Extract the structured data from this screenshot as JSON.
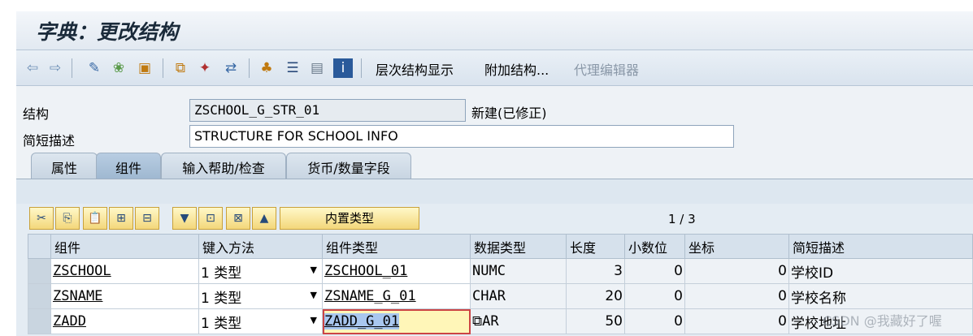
{
  "window": {
    "title": "字典：更改结构"
  },
  "toolbar": {
    "items": [
      "层次结构显示",
      "附加结构...",
      "代理编辑器"
    ]
  },
  "form": {
    "structure_label": "结构",
    "structure_value": "ZSCHOOL_G_STR_01",
    "status": "新建(已修正)",
    "desc_label": "简短描述",
    "desc_value": "STRUCTURE FOR SCHOOL INFO"
  },
  "tabs": [
    "属性",
    "组件",
    "输入帮助/检查",
    "货币/数量字段"
  ],
  "panel": {
    "builtin_type_label": "内置类型",
    "pager": "1 / 3"
  },
  "grid": {
    "headers": [
      "组件",
      "键入方法",
      "组件类型",
      "数据类型",
      "长度",
      "小数位",
      "坐标",
      "简短描述"
    ],
    "rows": [
      {
        "component": "ZSCHOOL",
        "method": "1 类型",
        "comp_type": "ZSCHOOL_01",
        "data_type": "NUMC",
        "length": "3",
        "decimals": "0",
        "coord": "0",
        "desc": "学校ID"
      },
      {
        "component": "ZSNAME",
        "method": "1 类型",
        "comp_type": "ZSNAME_G_01",
        "data_type": "CHAR",
        "length": "20",
        "decimals": "0",
        "coord": "0",
        "desc": "学校名称"
      },
      {
        "component": "ZADD",
        "method": "1 类型",
        "comp_type": "ZADD_G_01",
        "data_type": "AR",
        "length": "50",
        "decimals": "0",
        "coord": "0",
        "desc": "学校地址"
      }
    ]
  },
  "watermark": "CSDN @我藏好了喔",
  "colors": {
    "accent": "#1a5fb4",
    "button_yellow": "#f3d77a",
    "header_bg": "#d6e1ec"
  }
}
